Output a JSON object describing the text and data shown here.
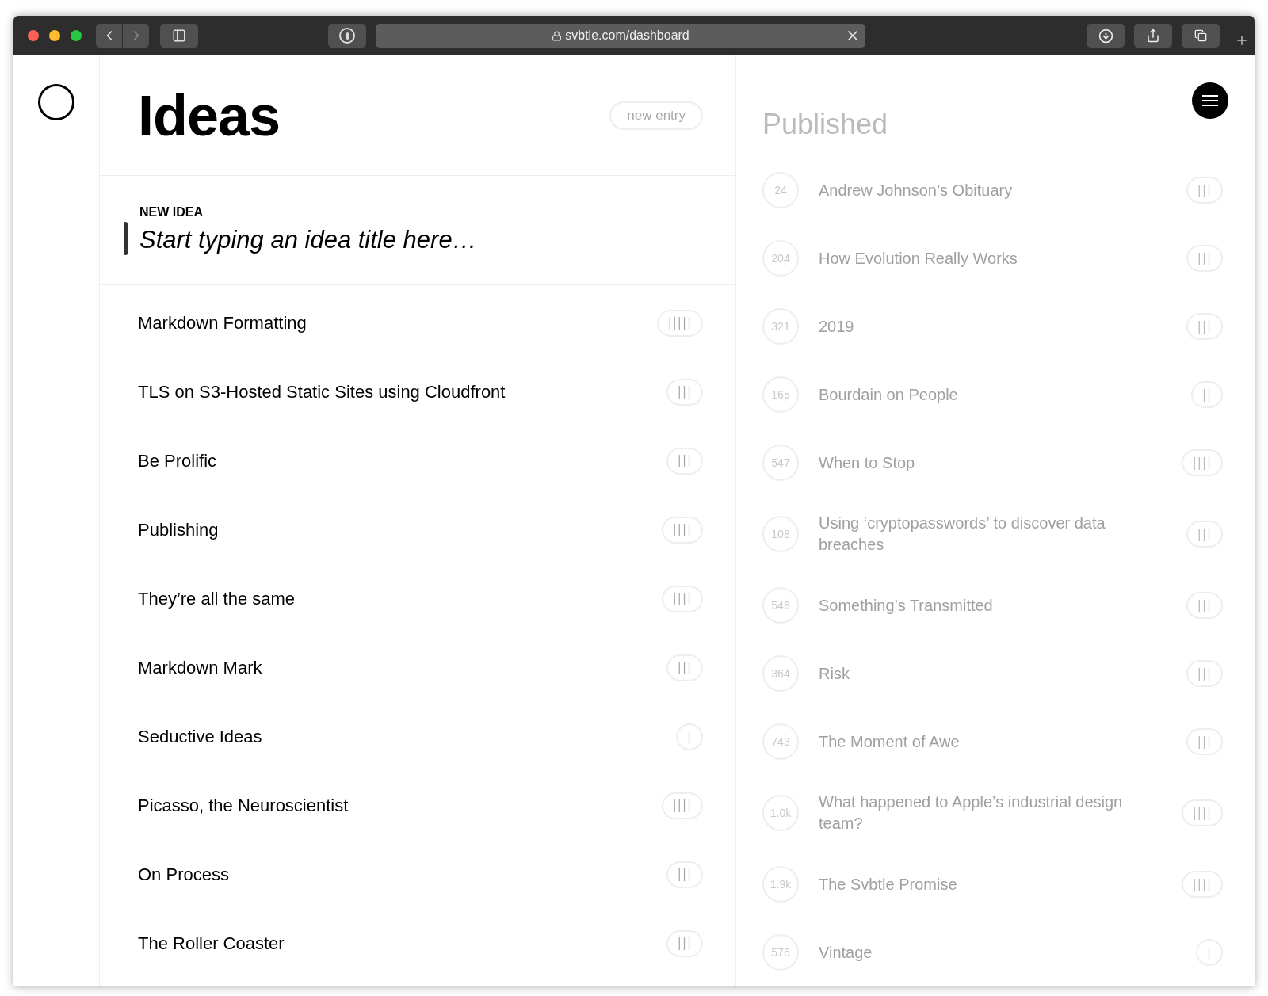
{
  "browser": {
    "url": "svbtle.com/dashboard"
  },
  "ideas": {
    "title": "Ideas",
    "new_entry_button": "new entry",
    "new_idea_label": "NEW IDEA",
    "new_idea_placeholder": "Start typing an idea title here…",
    "items": [
      {
        "title": "Markdown Formatting",
        "tally": "|||||"
      },
      {
        "title": "TLS on S3-Hosted Static Sites using Cloudfront",
        "tally": "|||"
      },
      {
        "title": "Be Prolific",
        "tally": "|||"
      },
      {
        "title": "Publishing",
        "tally": "||||"
      },
      {
        "title": "They’re all the same",
        "tally": "||||"
      },
      {
        "title": "Markdown Mark",
        "tally": "|||"
      },
      {
        "title": "Seductive Ideas",
        "tally": "|"
      },
      {
        "title": "Picasso, the Neuroscientist",
        "tally": "||||"
      },
      {
        "title": "On Process",
        "tally": "|||"
      },
      {
        "title": "The Roller Coaster",
        "tally": "|||"
      }
    ]
  },
  "published": {
    "title": "Published",
    "items": [
      {
        "count": "24",
        "title": "Andrew Johnson’s Obituary",
        "tally": "|||"
      },
      {
        "count": "204",
        "title": "How Evolution Really Works",
        "tally": "|||"
      },
      {
        "count": "321",
        "title": "2019",
        "tally": "|||"
      },
      {
        "count": "165",
        "title": "Bourdain on People",
        "tally": "||"
      },
      {
        "count": "547",
        "title": "When to Stop",
        "tally": "||||"
      },
      {
        "count": "108",
        "title": "Using ‘cryptopasswords’ to discover data breaches",
        "tally": "|||"
      },
      {
        "count": "546",
        "title": "Something’s Transmitted",
        "tally": "|||"
      },
      {
        "count": "364",
        "title": "Risk",
        "tally": "|||"
      },
      {
        "count": "743",
        "title": "The Moment of Awe",
        "tally": "|||"
      },
      {
        "count": "1.0k",
        "title": "What happened to Apple’s industrial design team?",
        "tally": "||||"
      },
      {
        "count": "1.9k",
        "title": "The Svbtle Promise",
        "tally": "||||"
      },
      {
        "count": "576",
        "title": "Vintage",
        "tally": "|"
      }
    ]
  }
}
